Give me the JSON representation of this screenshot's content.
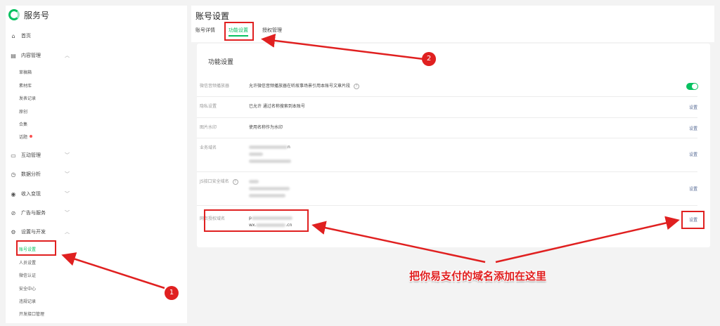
{
  "brand": {
    "name": "服务号",
    "accent": "#07c160"
  },
  "sidebar": {
    "home": "首页",
    "content": {
      "label": "内容管理",
      "items": [
        "草稿箱",
        "素材库",
        "发表记录",
        "原创",
        "合集",
        "话题"
      ]
    },
    "interaction": "互动管理",
    "analytics": "数据分析",
    "revenue": "收入变现",
    "ads": "广告与服务",
    "settings": {
      "label": "设置与开发",
      "items": [
        "账号设置",
        "人员设置",
        "微信认证",
        "安全中心",
        "违规记录",
        "开发接口管理"
      ]
    }
  },
  "header": {
    "title": "账号设置",
    "tabs": [
      "账号详情",
      "功能设置",
      "授权管理"
    ]
  },
  "panel": {
    "title": "功能设置",
    "rows": [
      {
        "label": "微信音频播放器",
        "value": "允许微信音频播放器在听故事场景引用本账号文章片段"
      },
      {
        "label": "隐私设置",
        "value": "已允许 通过名称搜索到本账号",
        "link": "设置"
      },
      {
        "label": "图片水印",
        "value": "使用名称作为水印",
        "link": "设置"
      },
      {
        "label": "业务域名",
        "value_line1": "n",
        "link": "设置"
      },
      {
        "label": "JS接口安全域名",
        "link": "设置"
      },
      {
        "label": "网页授权域名",
        "value_line1": "p",
        "value_line2": "wx.",
        "value_line2_end": ".cn",
        "link": "设置"
      }
    ]
  },
  "annotations": {
    "badge1": "1",
    "badge2": "2",
    "callout": "把你易支付的域名添加在这里",
    "color": "#e02020"
  }
}
